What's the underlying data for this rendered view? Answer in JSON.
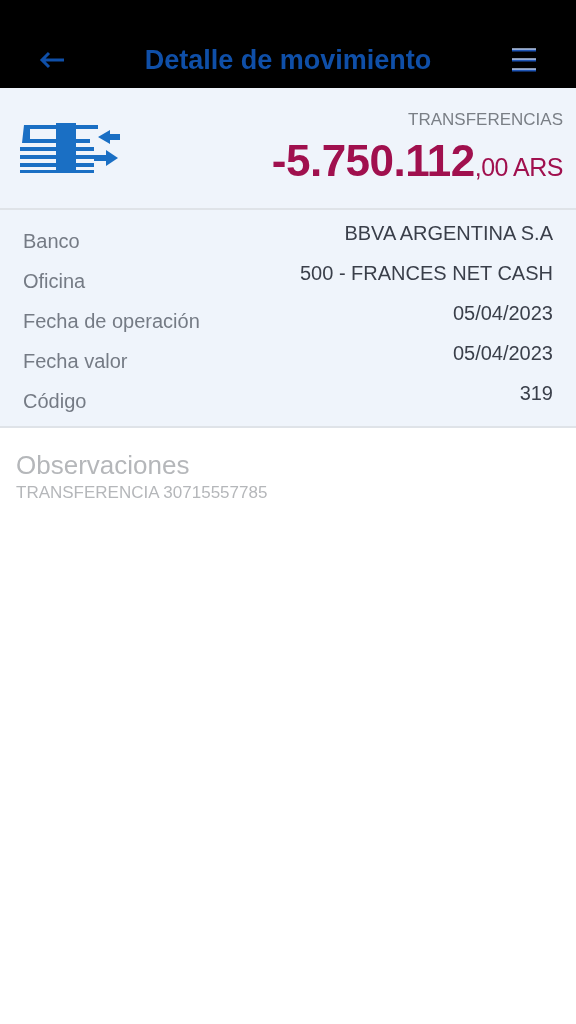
{
  "header": {
    "title": "Detalle de movimiento"
  },
  "summary": {
    "category": "TRANSFERENCIAS",
    "amount_main": "-5.750.112",
    "amount_decimals": ",00 ARS"
  },
  "details": [
    {
      "label": "Banco",
      "value": "BBVA ARGENTINA S.A"
    },
    {
      "label": "Oficina",
      "value": "500 - FRANCES NET CASH"
    },
    {
      "label": "Fecha de operación",
      "value": "05/04/2023"
    },
    {
      "label": "Fecha valor",
      "value": "05/04/2023"
    },
    {
      "label": "Código",
      "value": "319"
    }
  ],
  "observations": {
    "title": "Observaciones",
    "text": "TRANSFERENCIA 30715557785"
  }
}
